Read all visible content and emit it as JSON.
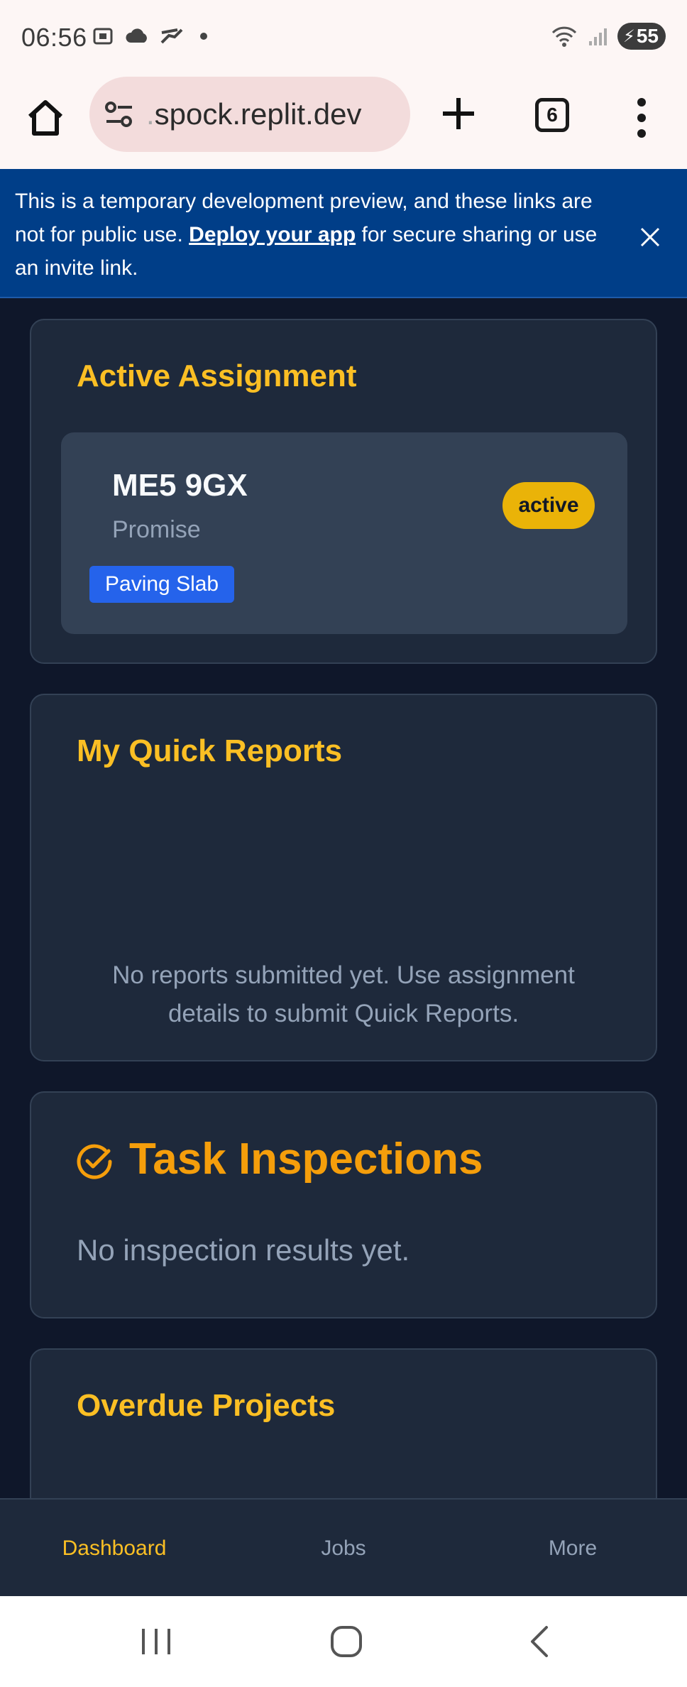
{
  "status_bar": {
    "time": "06:56",
    "battery": "55"
  },
  "browser": {
    "url_prefix": ".",
    "url": "spock.replit.dev",
    "tab_count": "6"
  },
  "banner": {
    "text_before": "This is a temporary development preview, and these links are not for public use. ",
    "link": "Deploy your app",
    "text_after": " for secure sharing or use an invite link."
  },
  "active_assignment": {
    "title": "Active Assignment",
    "code": "ME5 9GX",
    "subtitle": "Promise",
    "tag": "Paving Slab",
    "status": "active"
  },
  "quick_reports": {
    "title": "My Quick Reports",
    "empty_line1": "No reports submitted yet. Use assignment",
    "empty_line2": "details to submit Quick Reports."
  },
  "task_inspections": {
    "title": "Task Inspections",
    "empty": "No inspection results yet."
  },
  "overdue_projects": {
    "title": "Overdue Projects"
  },
  "bottom_nav": {
    "items": [
      {
        "label": "Dashboard"
      },
      {
        "label": "Jobs"
      },
      {
        "label": "More"
      }
    ]
  },
  "colors": {
    "accent": "#fbbf24",
    "background": "#0f172a",
    "card": "#1e293b",
    "banner": "#003e88",
    "tag_blue": "#2563eb",
    "status_yellow": "#eab308"
  }
}
